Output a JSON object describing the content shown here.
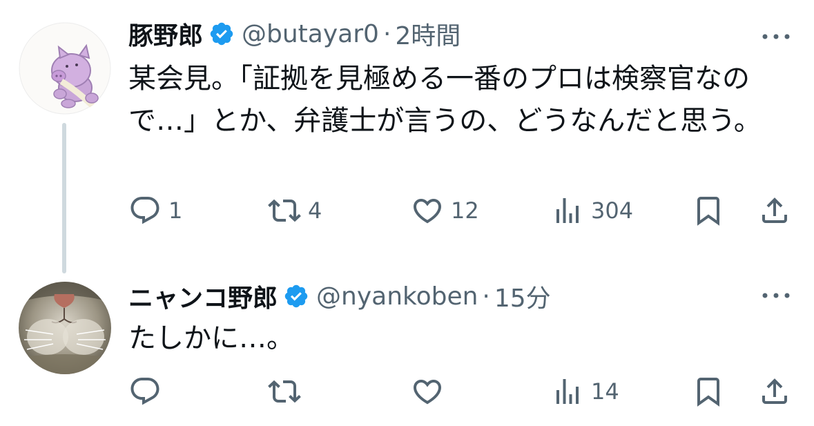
{
  "tweets": [
    {
      "name": "豚野郎",
      "handle": "@butayar0",
      "dot": "·",
      "time": "2時間",
      "text": "某会見。「証拠を見極める一番のプロは検察官なので…」とか、弁護士が言うの、どうなんだと思う。",
      "replies": "1",
      "retweets": "4",
      "likes": "12",
      "views": "304"
    },
    {
      "name": "ニャンコ野郎",
      "handle": "@nyankoben",
      "dot": "·",
      "time": "15分",
      "text": "たしかに…。",
      "replies": "",
      "retweets": "",
      "likes": "",
      "views": "14"
    }
  ],
  "icons": {
    "verified": "verified-badge-icon",
    "more": "more-dots-icon",
    "reply": "reply-icon",
    "retweet": "retweet-icon",
    "like": "heart-icon",
    "views": "views-icon",
    "bookmark": "bookmark-icon",
    "share": "share-icon"
  },
  "colors": {
    "verified_blue": "#1d9bf0",
    "icon_gray": "#536471",
    "text": "#0f1419",
    "thread_line": "#cfd9de"
  }
}
